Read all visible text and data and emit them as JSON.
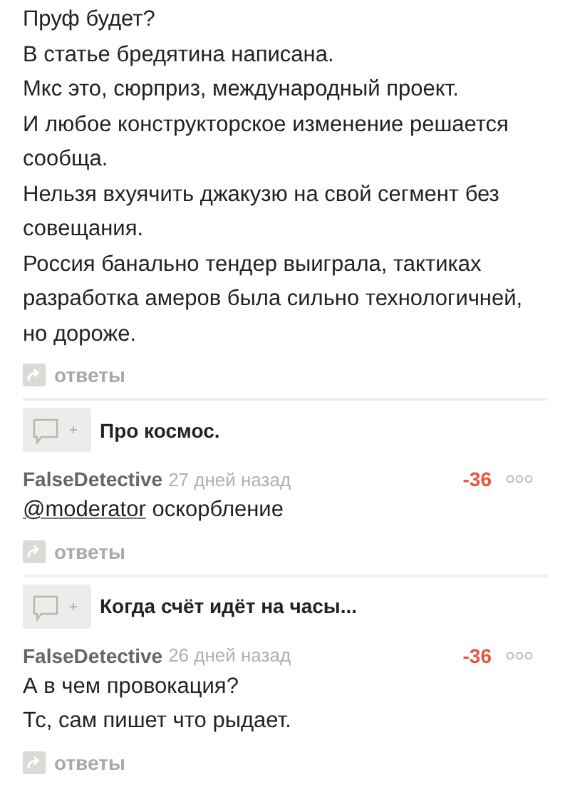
{
  "comments": [
    {
      "body": [
        "Пруф будет?",
        "В статье бредятина написана.",
        "Мкс это, сюрприз, международный проект.",
        "И любое конструкторское изменение решается сообща.",
        "Нельзя вхуячить джакузю на свой сегмент без совещания.",
        "Россия банально тендер выиграла, тактиках разработка амеров была сильно технологичней, но дороже."
      ],
      "replies": "ответы"
    },
    {
      "thread_title": "Про космос.",
      "author": "FalseDetective",
      "time": "27 дней назад",
      "score": "-36",
      "mention": "@moderator",
      "body": [
        "оскорбление"
      ],
      "replies": "ответы"
    },
    {
      "thread_title": "Когда счёт идёт на часы...",
      "author": "FalseDetective",
      "time": "26 дней назад",
      "score": "-36",
      "body": [
        "А в чем провокация?",
        "Тс, сам пишет что рыдает."
      ],
      "replies": "ответы"
    }
  ]
}
